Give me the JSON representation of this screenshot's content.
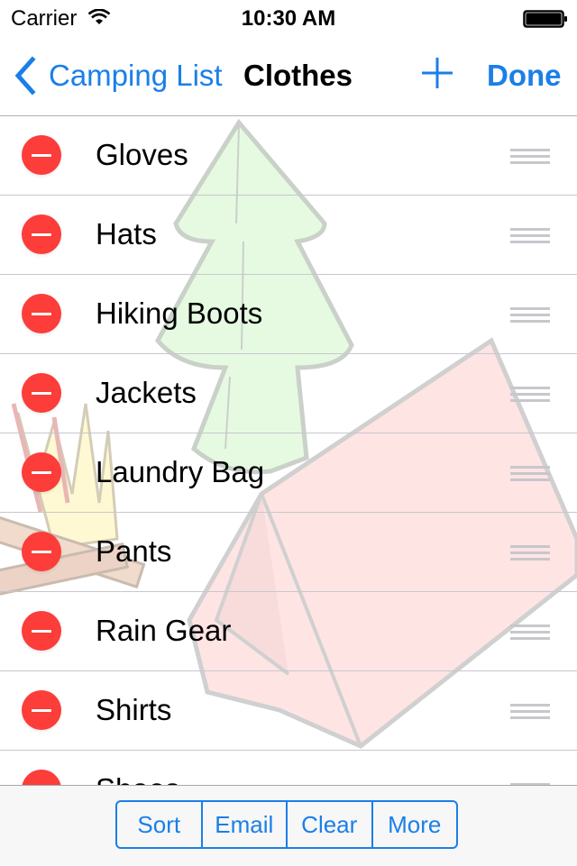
{
  "status_bar": {
    "carrier": "Carrier",
    "time": "10:30 AM",
    "wifi_icon": "wifi-icon",
    "battery_icon": "battery-full-icon"
  },
  "nav_bar": {
    "back_label": "Camping List",
    "back_icon": "chevron-left-icon",
    "title": "Clothes",
    "add_icon": "plus-icon",
    "done_label": "Done"
  },
  "colors": {
    "accent": "#1a7fe8",
    "delete": "#fc3d39",
    "separator": "#c8c7cc",
    "reorder_handle": "#c7c7cc",
    "toolbar_bg": "#f7f7f7"
  },
  "items": [
    {
      "label": "Gloves"
    },
    {
      "label": "Hats"
    },
    {
      "label": "Hiking Boots"
    },
    {
      "label": "Jackets"
    },
    {
      "label": "Laundry Bag"
    },
    {
      "label": "Pants"
    },
    {
      "label": "Rain Gear"
    },
    {
      "label": "Shirts"
    },
    {
      "label": "Shoes"
    }
  ],
  "toolbar": {
    "segments": [
      {
        "label": "Sort"
      },
      {
        "label": "Email"
      },
      {
        "label": "Clear"
      },
      {
        "label": "More"
      }
    ]
  }
}
